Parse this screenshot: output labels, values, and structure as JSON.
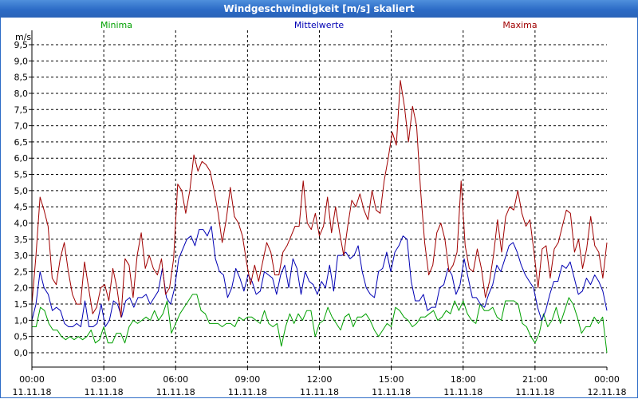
{
  "window": {
    "title": "Windgeschwindigkeit [m/s] skaliert"
  },
  "chart_data": {
    "type": "line",
    "title": "Windgeschwindigkeit [m/s] skaliert",
    "ylabel": "m/s",
    "xlabel": "",
    "ylim": [
      0,
      9.5
    ],
    "xlim": [
      0,
      24
    ],
    "grid": true,
    "legend_placement": "top",
    "y_ticks": [
      "0,0",
      "0,5",
      "1,0",
      "1,5",
      "2,0",
      "2,5",
      "3,0",
      "3,5",
      "4,0",
      "4,5",
      "5,0",
      "5,5",
      "6,0",
      "6,5",
      "7,0",
      "7,5",
      "8,0",
      "8,5",
      "9,0",
      "9,5"
    ],
    "x_ticks": [
      {
        "time": "00:00",
        "date": "11.11.18"
      },
      {
        "time": "03:00",
        "date": "11.11.18"
      },
      {
        "time": "06:00",
        "date": "11.11.18"
      },
      {
        "time": "09:00",
        "date": "11.11.18"
      },
      {
        "time": "12:00",
        "date": "11.11.18"
      },
      {
        "time": "15:00",
        "date": "11.11.18"
      },
      {
        "time": "18:00",
        "date": "11.11.18"
      },
      {
        "time": "21:00",
        "date": "11.11.18"
      },
      {
        "time": "00:00",
        "date": "12.11.18"
      }
    ],
    "series": [
      {
        "name": "Minima",
        "color": "#00a000",
        "values": [
          0.8,
          0.8,
          1.4,
          1.3,
          0.9,
          0.7,
          0.7,
          0.5,
          0.4,
          0.5,
          0.4,
          0.5,
          0.4,
          0.5,
          0.7,
          0.3,
          0.4,
          0.8,
          0.3,
          0.3,
          0.6,
          0.6,
          0.3,
          0.8,
          1.0,
          0.9,
          1.0,
          1.1,
          1.0,
          1.3,
          1.0,
          1.2,
          1.6,
          0.6,
          0.9,
          1.2,
          1.4,
          1.6,
          1.8,
          1.8,
          1.3,
          1.2,
          0.9,
          0.9,
          0.9,
          0.8,
          0.9,
          0.9,
          0.8,
          1.1,
          1.0,
          1.1,
          1.1,
          1.0,
          0.9,
          1.3,
          0.9,
          0.8,
          0.9,
          0.2,
          0.8,
          1.2,
          0.9,
          1.2,
          1.0,
          1.3,
          1.3,
          0.5,
          0.9,
          1.0,
          1.4,
          1.1,
          0.9,
          0.7,
          1.1,
          1.2,
          0.8,
          1.1,
          1.1,
          1.2,
          1.0,
          0.7,
          0.5,
          0.7,
          0.9,
          0.8,
          1.4,
          1.3,
          1.1,
          1.0,
          0.8,
          0.9,
          1.1,
          1.1,
          1.2,
          1.3,
          1.0,
          1.1,
          1.3,
          1.2,
          1.6,
          1.3,
          1.6,
          1.2,
          1.0,
          0.9,
          1.5,
          1.3,
          1.3,
          1.4,
          1.1,
          1.0,
          1.6,
          1.6,
          1.6,
          1.5,
          0.9,
          0.8,
          0.5,
          0.3,
          0.6,
          1.2,
          0.8,
          1.0,
          1.4,
          0.9,
          1.3,
          1.7,
          1.5,
          1.1,
          0.6,
          0.8,
          0.8,
          1.1,
          0.9,
          1.1,
          0.0
        ]
      },
      {
        "name": "Mittelwerte",
        "color": "#0000b4",
        "values": [
          1.0,
          1.5,
          2.5,
          2.0,
          1.8,
          1.3,
          1.4,
          1.3,
          0.9,
          0.8,
          0.8,
          0.9,
          0.8,
          1.6,
          0.8,
          0.8,
          0.9,
          1.5,
          0.8,
          1.0,
          1.6,
          1.5,
          1.1,
          1.6,
          1.7,
          1.4,
          1.7,
          1.7,
          1.8,
          1.5,
          1.7,
          1.9,
          2.6,
          1.7,
          1.5,
          2.0,
          2.9,
          3.2,
          3.5,
          3.6,
          3.3,
          3.8,
          3.8,
          3.6,
          3.9,
          2.9,
          2.5,
          2.4,
          1.7,
          2.0,
          2.6,
          2.3,
          1.9,
          2.4,
          2.2,
          1.8,
          1.9,
          2.5,
          2.4,
          2.3,
          1.8,
          2.4,
          2.7,
          2.0,
          2.9,
          2.6,
          1.8,
          2.5,
          2.2,
          2.1,
          1.8,
          2.2,
          2.0,
          2.7,
          1.9,
          3.0,
          3.0,
          3.1,
          2.9,
          3.0,
          3.3,
          2.5,
          2.0,
          1.8,
          1.7,
          2.5,
          2.6,
          3.1,
          2.5,
          3.1,
          3.3,
          3.6,
          3.5,
          2.2,
          1.6,
          1.6,
          1.8,
          1.3,
          1.4,
          1.4,
          2.0,
          2.1,
          2.6,
          2.4,
          1.8,
          2.1,
          2.9,
          2.3,
          1.7,
          1.7,
          1.5,
          1.4,
          1.8,
          2.1,
          2.7,
          2.5,
          2.9,
          3.3,
          3.4,
          3.1,
          2.7,
          2.4,
          2.2,
          2.0,
          1.4,
          1.0,
          1.3,
          1.8,
          2.2,
          2.2,
          2.7,
          2.6,
          2.8,
          2.3,
          1.8,
          1.9,
          2.3,
          2.1,
          2.4,
          2.2,
          1.9,
          1.3
        ]
      },
      {
        "name": "Maxima",
        "color": "#a00000",
        "values": [
          1.5,
          3.0,
          4.8,
          4.4,
          3.9,
          2.3,
          2.1,
          2.9,
          3.4,
          2.5,
          1.8,
          1.5,
          1.5,
          2.8,
          2.0,
          1.2,
          1.4,
          2.0,
          2.1,
          1.6,
          2.6,
          2.0,
          1.1,
          2.9,
          2.7,
          1.7,
          3.0,
          3.7,
          2.6,
          3.0,
          2.6,
          2.4,
          2.9,
          1.8,
          2.0,
          2.9,
          5.2,
          5.0,
          4.3,
          5.0,
          6.1,
          5.6,
          5.9,
          5.8,
          5.6,
          5.0,
          4.3,
          3.4,
          4.1,
          5.1,
          4.2,
          4.0,
          3.6,
          2.8,
          2.1,
          2.7,
          2.2,
          2.8,
          3.4,
          3.1,
          2.4,
          2.4,
          3.1,
          3.3,
          3.6,
          3.9,
          3.9,
          5.3,
          4.0,
          3.8,
          4.3,
          3.6,
          3.9,
          4.8,
          3.7,
          4.5,
          3.7,
          3.0,
          3.9,
          4.7,
          4.5,
          4.9,
          4.4,
          4.1,
          5.0,
          4.4,
          4.3,
          5.3,
          6.0,
          6.8,
          6.4,
          8.4,
          7.6,
          6.5,
          7.6,
          7.0,
          5.0,
          3.4,
          2.4,
          2.7,
          3.7,
          4.0,
          3.5,
          2.5,
          2.7,
          3.1,
          5.3,
          3.3,
          2.6,
          2.5,
          3.2,
          2.6,
          1.7,
          2.2,
          3.0,
          4.1,
          3.1,
          4.2,
          4.5,
          4.4,
          5.0,
          4.3,
          3.9,
          4.1,
          3.1,
          2.0,
          3.2,
          3.3,
          2.3,
          3.2,
          3.4,
          3.9,
          4.4,
          4.3,
          3.1,
          3.5,
          2.6,
          3.2,
          4.2,
          3.3,
          3.1,
          2.3,
          3.4
        ]
      }
    ]
  }
}
